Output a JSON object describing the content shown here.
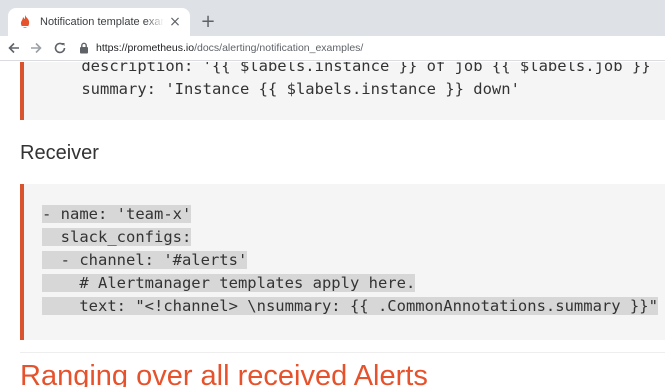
{
  "browser": {
    "tab_title": "Notification template examples",
    "tab_close": "×",
    "new_tab": "+",
    "url_host": "https://prometheus.io",
    "url_path": "/docs/alerting/notification_examples/"
  },
  "page": {
    "code_top_lines": [
      "    description: '{{ $labels.instance }} of job {{ $labels.job }}",
      "    summary: 'Instance {{ $labels.instance }} down'"
    ],
    "receiver_heading": "Receiver",
    "receiver_code_lines": [
      "- name: 'team-x'",
      "  slack_configs:",
      "  - channel: '#alerts'",
      "    # Alertmanager templates apply here.",
      "    text: \"<!channel> \\nsummary: {{ .CommonAnnotations.summary }}\""
    ],
    "next_heading": "Ranging over all received Alerts"
  },
  "colors": {
    "accent": "#e6522c",
    "code_border": "#d9532f",
    "code_bg": "#f5f5f5",
    "selection": "#d7d7d7"
  },
  "icons": {
    "favicon": "prometheus-flame-icon",
    "back": "arrow-left-icon",
    "forward": "arrow-right-icon",
    "reload": "reload-icon",
    "secure": "lock-icon"
  }
}
